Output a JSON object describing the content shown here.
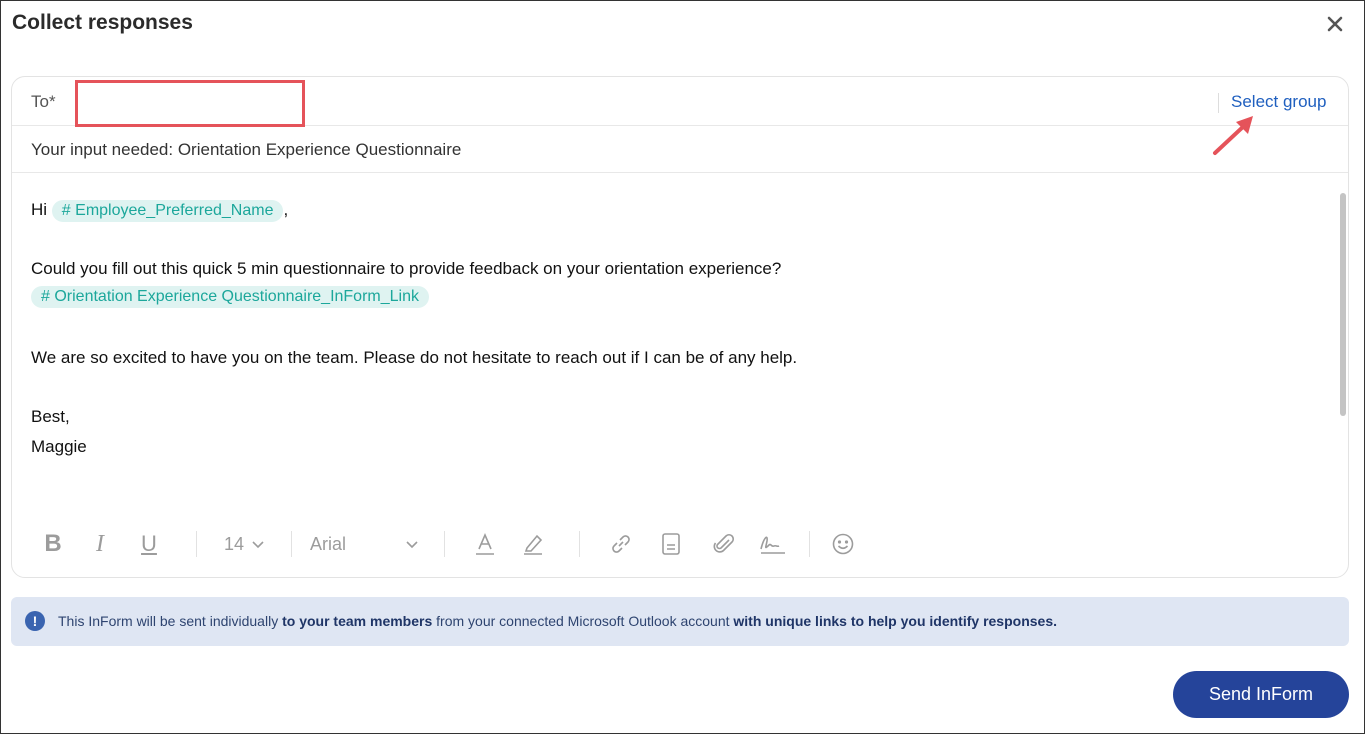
{
  "dialog": {
    "title": "Collect responses"
  },
  "to": {
    "label": "To*",
    "value": "",
    "placeholder": "",
    "select_group_label": "Select group"
  },
  "subject": {
    "text": "Your input needed: Orientation Experience Questionnaire"
  },
  "body": {
    "greeting": "Hi",
    "name_tag": "# Employee_Preferred_Name",
    "greeting_comma": ",",
    "request": "Could you fill out this quick 5 min questionnaire to provide feedback on your orientation experience?",
    "link_tag": "# Orientation Experience Questionnaire_InForm_Link",
    "closing_message": "We are so excited to have you on the team. Please do not hesitate to reach out if I can be of any help.",
    "signoff": "Best,",
    "signature": "Maggie"
  },
  "toolbar": {
    "bold": "B",
    "italic": "I",
    "underline": "U",
    "font_size": "14",
    "font_family": "Arial",
    "icons": [
      "bold-icon",
      "italic-icon",
      "underline-icon",
      "chevron-down-icon",
      "font-color-icon",
      "highlight-icon",
      "link-icon",
      "template-icon",
      "attachment-icon",
      "signature-icon",
      "emoji-icon"
    ]
  },
  "info": {
    "icon": "!",
    "text_1": "This InForm will be sent individually ",
    "bold_1": "to your team members",
    "text_2": " from your connected Microsoft Outlook account ",
    "bold_2": "with unique links to help you identify responses."
  },
  "actions": {
    "send_label": "Send InForm"
  },
  "colors": {
    "primary": "#25449a",
    "link": "#1f5fbf",
    "tag_bg": "#dff3f1",
    "tag_text": "#1ca79b",
    "highlight_box": "#e5535a",
    "info_bg": "#dfe6f3"
  }
}
